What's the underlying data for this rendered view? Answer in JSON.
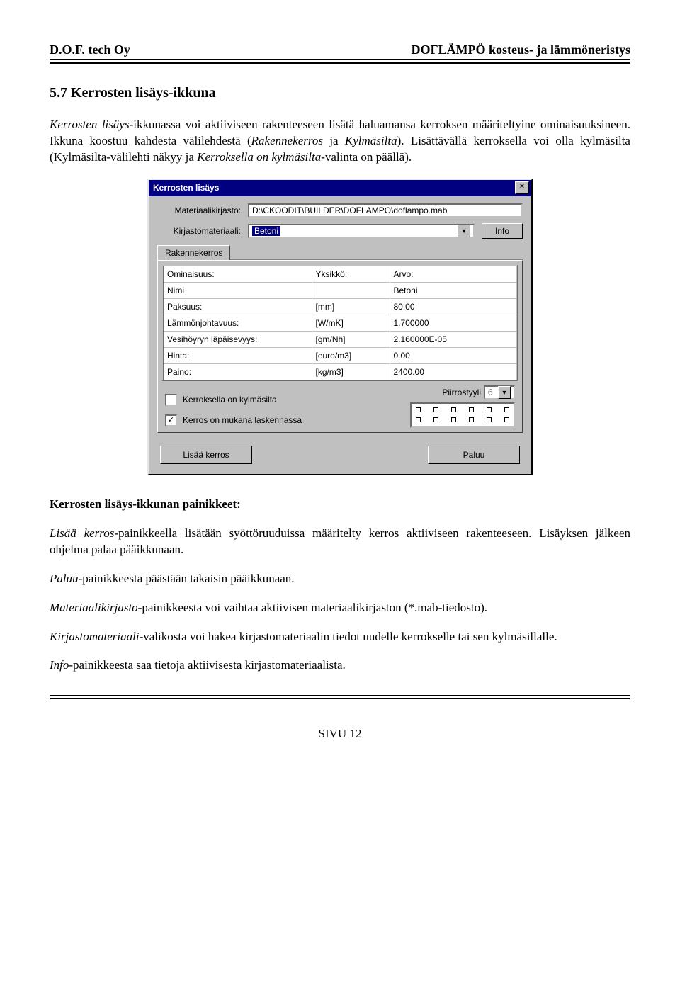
{
  "header": {
    "left": "D.O.F. tech Oy",
    "right": "DOFLÄMPÖ   kosteus- ja lämmöneristys"
  },
  "section_title": "5.7 Kerrosten lisäys-ikkuna",
  "para1a": "Kerrosten lisäys",
  "para1b": "-ikkunassa voi aktiiviseen rakenteeseen lisätä haluamansa kerroksen määriteltyine ominaisuuksineen. Ikkuna koostuu kahdesta välilehdestä (",
  "para1c": "Rakennekerros",
  "para1d": " ja ",
  "para1e": "Kylmäsilta",
  "para1f": "). Lisättävällä kerroksella voi olla kylmäsilta (Kylmäsilta-välilehti näkyy ja ",
  "para1g": "Kerroksella on kylmäsilta",
  "para1h": "-valinta on päällä).",
  "dialog": {
    "title": "Kerrosten lisäys",
    "lbl_matkirj": "Materiaalikirjasto:",
    "val_matkirj": "D:\\CKOODIT\\BUILDER\\DOFLAMPO\\doflampo.mab",
    "lbl_kirjmat": "Kirjastomateriaali:",
    "val_kirjmat": "Betoni",
    "btn_info": "Info",
    "tab": "Rakennekerros",
    "hdr_om": "Ominaisuus:",
    "hdr_yk": "Yksikkö:",
    "hdr_ar": "Arvo:",
    "rows": [
      {
        "p": "Nimi",
        "u": "",
        "v": "Betoni"
      },
      {
        "p": "Paksuus:",
        "u": "[mm]",
        "v": "80.00"
      },
      {
        "p": "Lämmönjohtavuus:",
        "u": "[W/mK]",
        "v": "1.700000"
      },
      {
        "p": "Vesihöyryn läpäisevyys:",
        "u": "[gm/Nh]",
        "v": "2.160000E-05"
      },
      {
        "p": "Hinta:",
        "u": "[euro/m3]",
        "v": "0.00"
      },
      {
        "p": "Paino:",
        "u": "[kg/m3]",
        "v": "2400.00"
      }
    ],
    "cb1": "Kerroksella on kylmäsilta",
    "cb2": "Kerros on mukana laskennassa",
    "lbl_piirto": "Piirrostyyli",
    "val_piirto": "6",
    "btn_add": "Lisää kerros",
    "btn_back": "Paluu"
  },
  "sub_heading": "Kerrosten lisäys-ikkunan painikkeet:",
  "p2a": "Lisää kerros",
  "p2b": "-painikkeella lisätään syöttöruuduissa määritelty kerros aktiiviseen rakenteeseen. Lisäyksen jälkeen ohjelma palaa pääikkunaan.",
  "p3a": "Paluu",
  "p3b": "-painikkeesta päästään takaisin pääikkunaan.",
  "p4a": "Materiaalikirjasto",
  "p4b": "-painikkeesta voi vaihtaa aktiivisen materiaalikirjaston (*.mab-tiedosto).",
  "p5a": "Kirjastomateriaali",
  "p5b": "-valikosta voi hakea kirjastomateriaalin tiedot uudelle kerrokselle tai sen kylmäsillalle.",
  "p6a": "Info",
  "p6b": "-painikkeesta saa tietoja aktiivisesta kirjastomateriaalista.",
  "footer": "SIVU 12"
}
